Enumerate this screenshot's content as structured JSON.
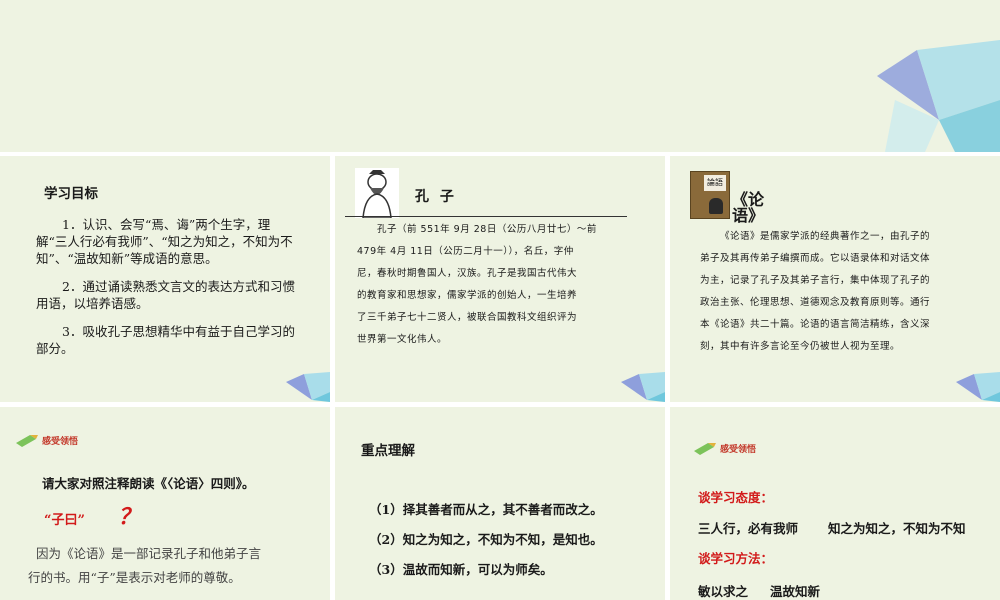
{
  "slide1": {
    "title": "学习目标",
    "item1": "1．认识、会写“焉、诲”两个生字，理解“三人行必有我师”、“知之为知之，不知为不知”、“温故知新”等成语的意思。",
    "item2": "2．通过诵读熟悉文言文的表达方式和习惯用语，以培养语感。",
    "item3": "3．吸收孔子思想精华中有益于自己学习的部分。"
  },
  "slide2": {
    "name": "孔 子",
    "bio": [
      "孔子（前 551年 9月 28日（公历八月廿七）～前",
      "479年 4月 11日（公历二月十一）），名丘，字仲",
      "尼，春秋时期鲁国人，汉族。孔子是我国古代伟大",
      "的教育家和思想家，儒家学派的创始人，一生培养",
      "了三千弟子七十二贤人，被联合国教科文组织评为",
      "世界第一文化伟人。"
    ]
  },
  "slide3": {
    "title": "《论语》",
    "book_label": "論語",
    "text": [
      "《论语》是儒家学派的经典著作之一，由孔子的",
      "弟子及其再传弟子编撰而成。它以语录体和对话文体",
      "为主，记录了孔子及其弟子言行，集中体现了孔子的",
      "政治主张、伦理思想、道德观念及教育原则等。通行",
      "本《论语》共二十篇。论语的语言简洁精练，含义深",
      "刻，其中有许多言论至今仍被世人视为至理。"
    ]
  },
  "slide4": {
    "badge": "感受领悟",
    "instruction": "请大家对照注释朗读《〈论语〉四则》。",
    "quote": "“子曰”",
    "qmark": "？",
    "explain1": "因为《论语》是一部记录孔子和他弟子言",
    "explain2": "行的书。用“子”是表示对老师的尊敬。"
  },
  "slide5": {
    "title": "重点理解",
    "points": [
      "（1）择其善者而从之，其不善者而改之。",
      "（2）知之为知之，不知为不知，是知也。",
      "（3）温故而知新，可以为师矣。"
    ]
  },
  "slide6": {
    "badge": "感受领悟",
    "attitude_label": "谈学习态度：",
    "attitude_a": "三人行，必有我师",
    "attitude_b": "知之为知之，不知为不知",
    "method_label": "谈学习方法：",
    "method_a": "敏以求之",
    "method_b": "温故知新"
  }
}
